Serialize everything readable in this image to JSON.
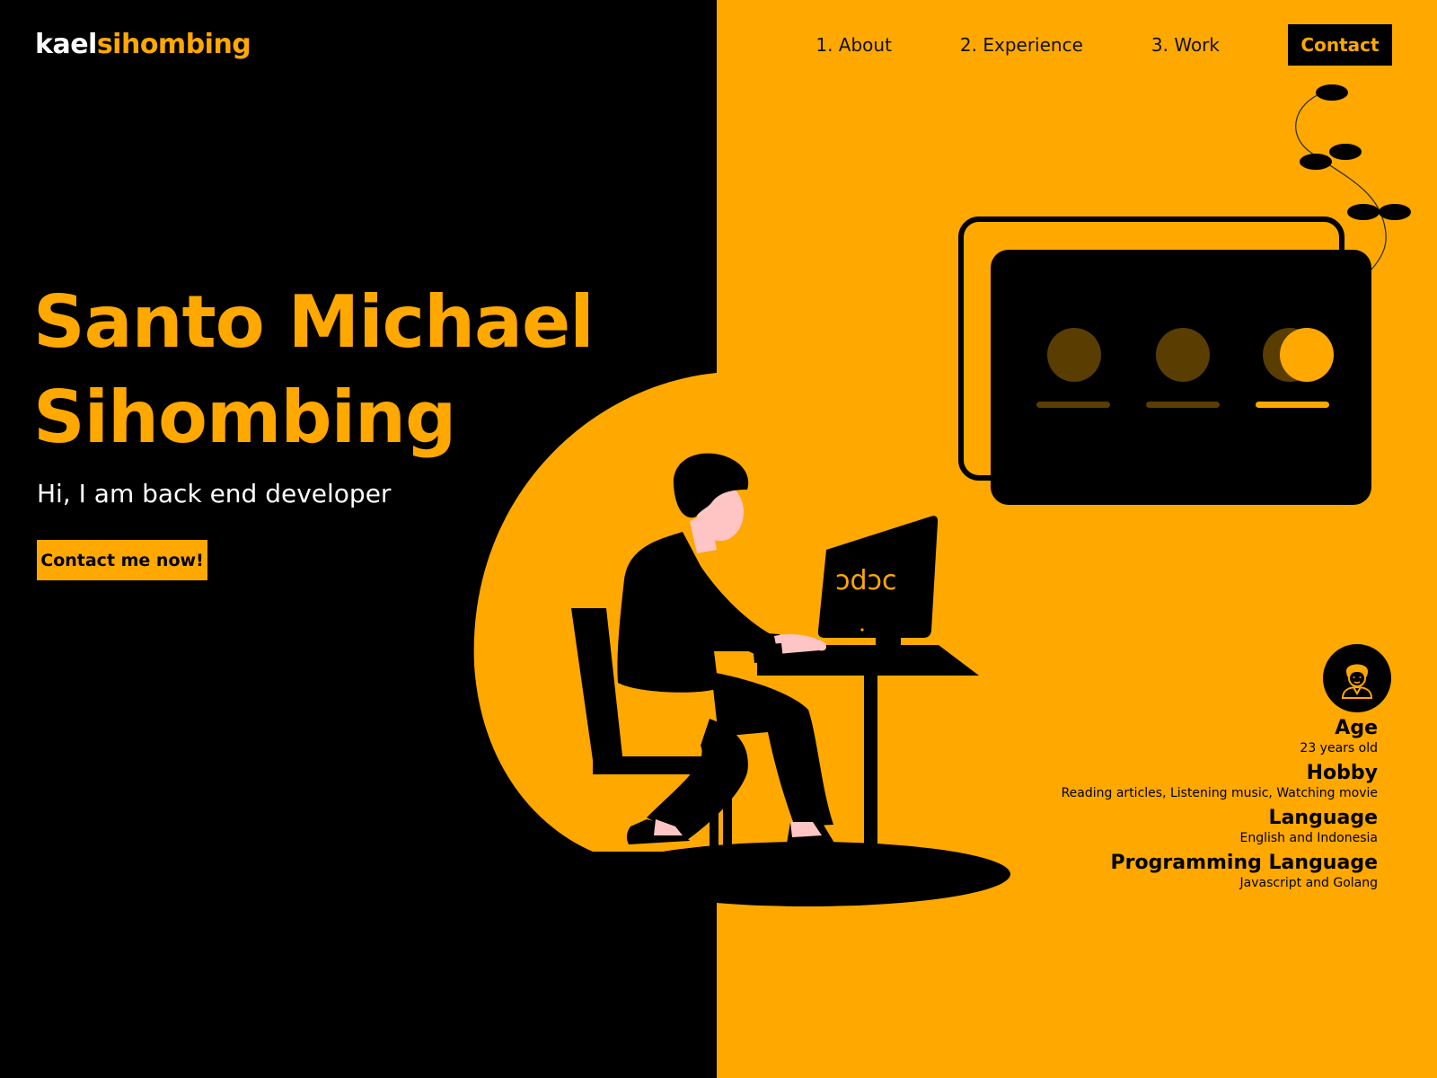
{
  "header": {
    "logo": {
      "first": "kael",
      "second": "sihombing"
    },
    "nav": [
      {
        "label": "1. About"
      },
      {
        "label": "2. Experience"
      },
      {
        "label": "3. Work"
      }
    ],
    "contact_label": "Contact"
  },
  "hero": {
    "title_line1": "Santo Michael",
    "title_line2": "Sihombing",
    "subtitle": "Hi, I am back end developer",
    "cta_label": "Contact me now!"
  },
  "monitor_code": "ɔdɔc",
  "profile": {
    "avatar_icon": "developer-avatar-icon",
    "items": [
      {
        "label": "Age",
        "value": "23 years old"
      },
      {
        "label": "Hobby",
        "value": "Reading articles, Listening music, Watching movie"
      },
      {
        "label": "Language",
        "value": "English and Indonesia"
      },
      {
        "label": "Programming Language",
        "value": "Javascript and Golang"
      }
    ]
  },
  "colors": {
    "accent": "#FFA800",
    "dark": "#000000",
    "light": "#FFFFFF",
    "skin": "#FFC5C5"
  }
}
